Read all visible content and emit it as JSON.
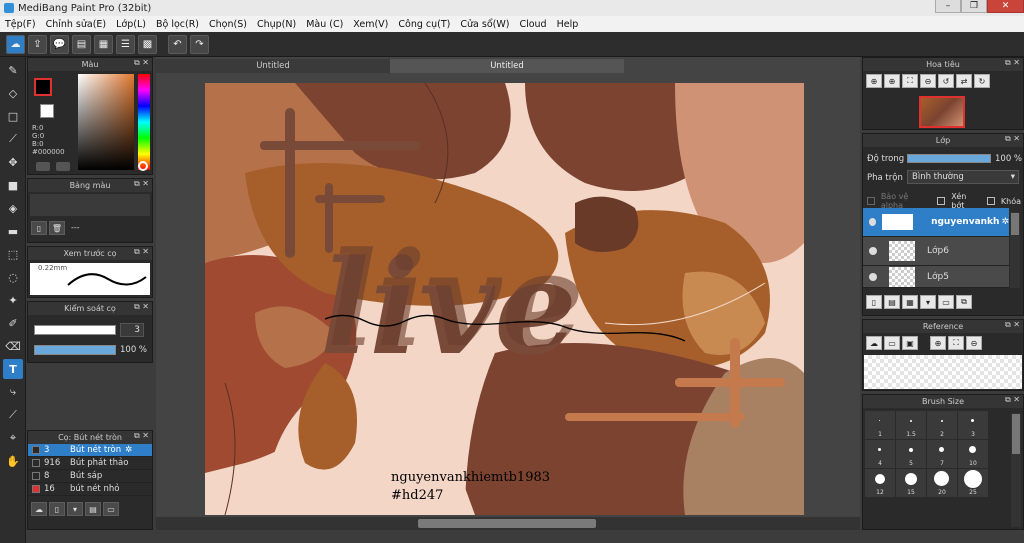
{
  "window": {
    "title": "MediBang Paint Pro (32bit)",
    "min": "–",
    "max": "❐",
    "close": "✕"
  },
  "menu": [
    "Tệp(F)",
    "Chỉnh sửa(E)",
    "Lớp(L)",
    "Bộ lọc(R)",
    "Chọn(S)",
    "Chụp(N)",
    "Màu (C)",
    "Xem(V)",
    "Công cụ(T)",
    "Cửa sổ(W)",
    "Cloud",
    "Help"
  ],
  "doc_tabs": [
    "Untitled",
    "Untitled"
  ],
  "color_panel": {
    "title": "Màu",
    "r": "R:0",
    "g": "G:0",
    "b": "B:0",
    "hex": "#000000"
  },
  "palette_panel": {
    "title": "Bảng màu",
    "none": "---"
  },
  "brush_preview": {
    "title": "Xem trước cọ",
    "size": "0.22mm"
  },
  "brush_control": {
    "title": "Kiểm soát cọ",
    "size": "3",
    "opacity": "100 %"
  },
  "brush_list": {
    "title": "Cọ: Bút nét tròn",
    "items": [
      {
        "size": "3",
        "name": "Bút nét tròn",
        "color": "#2a2a2a"
      },
      {
        "size": "916",
        "name": "Bút phát thảo",
        "color": "#2a2a2a"
      },
      {
        "size": "8",
        "name": "Bút sáp",
        "color": "#2a2a2a"
      },
      {
        "size": "16",
        "name": "bút nét nhỏ",
        "color": "#e03030"
      }
    ]
  },
  "navigator": {
    "title": "Hoa tiêu"
  },
  "layer_panel": {
    "title": "Lớp",
    "opacity_label": "Độ trong",
    "opacity_value": "100 %",
    "opacity_fraction": 1.0,
    "blend_label": "Pha trộn",
    "blend_value": "Bình thường",
    "protect_alpha": "Bảo vệ alpha",
    "clipping": "Xén bớt",
    "lock": "Khóa",
    "layers": [
      "nguyenvankh",
      "Lớp6",
      "Lớp5"
    ]
  },
  "reference_panel": {
    "title": "Reference"
  },
  "brush_size_panel": {
    "title": "Brush Size",
    "sizes": [
      "1",
      "1.5",
      "2",
      "3",
      "4",
      "5",
      "7",
      "10",
      "12",
      "15",
      "20",
      "25"
    ]
  },
  "canvas_text": {
    "line1": "nguyenvankhiemtb1983",
    "line2": "#hd247"
  },
  "colors": {
    "accent": "#2f7fc8",
    "primary_color": "#000000"
  }
}
